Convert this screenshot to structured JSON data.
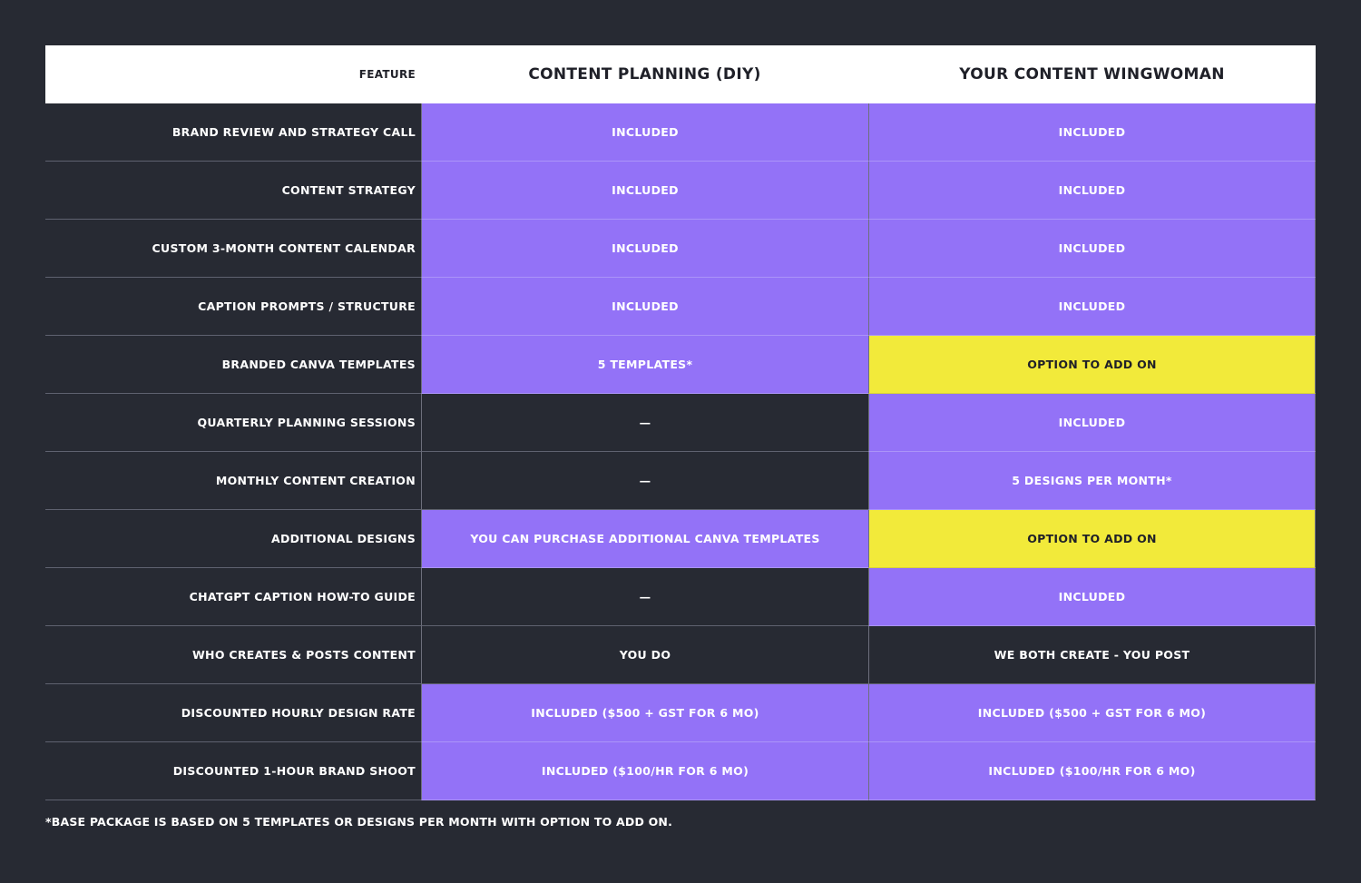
{
  "colors": {
    "background": "#272a33",
    "header_bg": "#ffffff",
    "included_purple": "#9372f7",
    "add_on_yellow": "#f2ea3a"
  },
  "header": {
    "feature": "FEATURE",
    "plan_a": "CONTENT PLANNING (DIY)",
    "plan_b": "YOUR CONTENT WINGWOMAN"
  },
  "rows": [
    {
      "feature": "BRAND REVIEW AND STRATEGY CALL",
      "plan_a": "INCLUDED",
      "plan_a_style": "purple",
      "plan_b": "INCLUDED",
      "plan_b_style": "purple"
    },
    {
      "feature": "CONTENT STRATEGY",
      "plan_a": "INCLUDED",
      "plan_a_style": "purple",
      "plan_b": "INCLUDED",
      "plan_b_style": "purple"
    },
    {
      "feature": "CUSTOM 3-MONTH CONTENT CALENDAR",
      "plan_a": "INCLUDED",
      "plan_a_style": "purple",
      "plan_b": "INCLUDED",
      "plan_b_style": "purple"
    },
    {
      "feature": "CAPTION PROMPTS / STRUCTURE",
      "plan_a": "INCLUDED",
      "plan_a_style": "purple",
      "plan_b": "INCLUDED",
      "plan_b_style": "purple"
    },
    {
      "feature": "BRANDED CANVA TEMPLATES",
      "plan_a": "5 TEMPLATES*",
      "plan_a_style": "purple",
      "plan_b": "OPTION TO ADD ON",
      "plan_b_style": "yellow"
    },
    {
      "feature": "QUARTERLY PLANNING SESSIONS",
      "plan_a": "—",
      "plan_a_style": "dark",
      "plan_b": "INCLUDED",
      "plan_b_style": "purple"
    },
    {
      "feature": "MONTHLY CONTENT CREATION",
      "plan_a": "—",
      "plan_a_style": "dark",
      "plan_b": "5 DESIGNS PER MONTH*",
      "plan_b_style": "purple"
    },
    {
      "feature": "ADDITIONAL DESIGNS",
      "plan_a": "YOU CAN PURCHASE ADDITIONAL CANVA TEMPLATES",
      "plan_a_style": "purple",
      "plan_b": "OPTION TO ADD ON",
      "plan_b_style": "yellow"
    },
    {
      "feature": "CHATGPT CAPTION HOW-TO GUIDE",
      "plan_a": "—",
      "plan_a_style": "dark",
      "plan_b": "INCLUDED",
      "plan_b_style": "purple"
    },
    {
      "feature": "WHO CREATES & POSTS CONTENT",
      "plan_a": "YOU DO",
      "plan_a_style": "dark",
      "plan_b": "WE BOTH CREATE - YOU POST",
      "plan_b_style": "dark"
    },
    {
      "feature": "DISCOUNTED HOURLY DESIGN RATE",
      "plan_a": "INCLUDED ($500 + GST FOR 6 MO)",
      "plan_a_style": "purple",
      "plan_b": "INCLUDED ($500 + GST FOR 6 MO)",
      "plan_b_style": "purple"
    },
    {
      "feature": "DISCOUNTED 1-HOUR BRAND SHOOT",
      "plan_a": "INCLUDED ($100/HR FOR 6 MO)",
      "plan_a_style": "purple",
      "plan_b": "INCLUDED ($100/HR FOR 6 MO)",
      "plan_b_style": "purple"
    }
  ],
  "footnote": "*BASE PACKAGE IS BASED ON 5 TEMPLATES OR DESIGNS PER MONTH WITH OPTION TO ADD ON."
}
